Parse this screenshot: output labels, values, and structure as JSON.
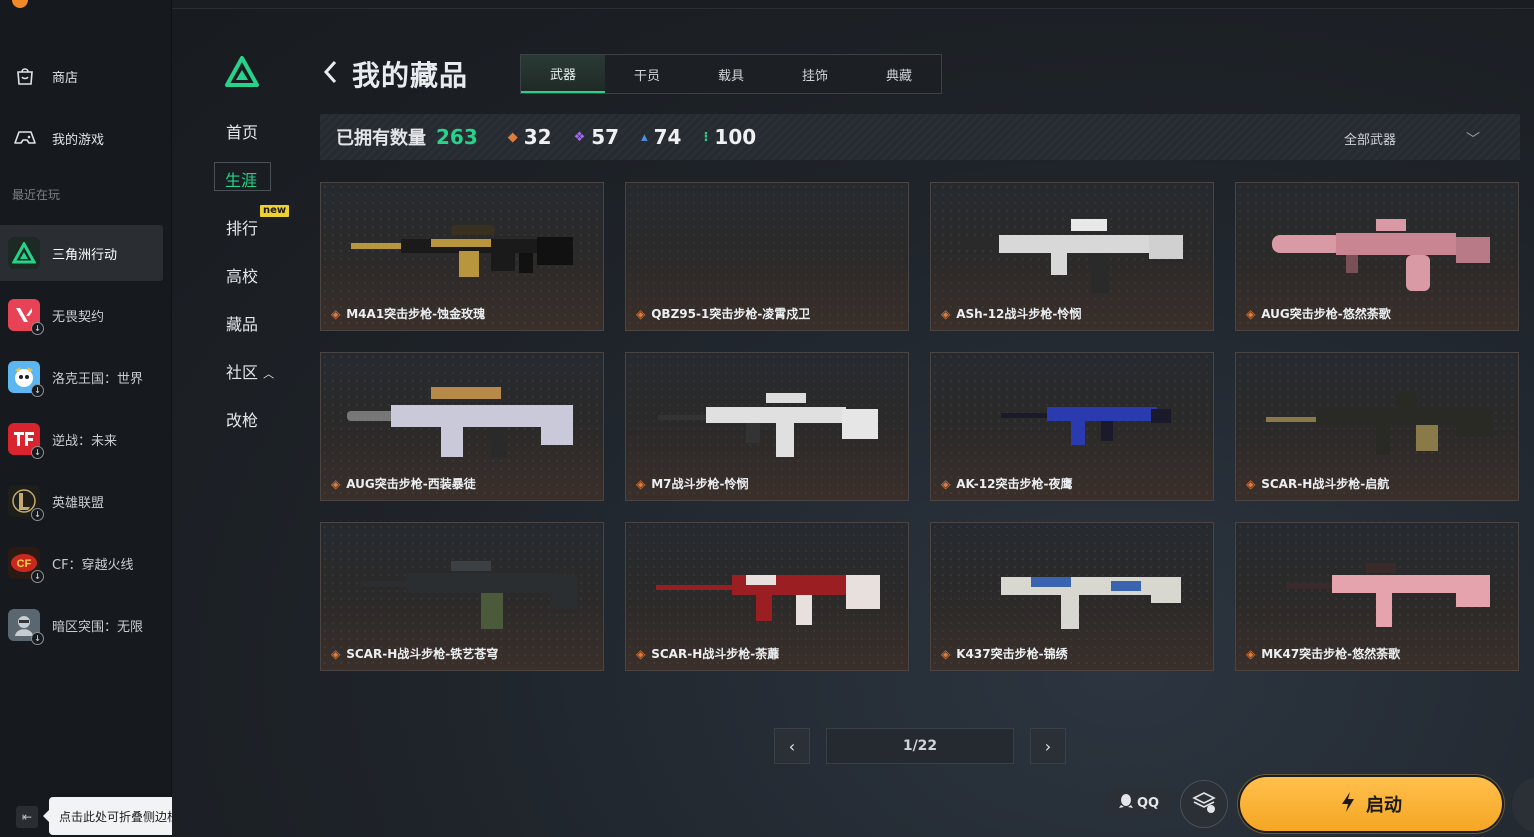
{
  "launcher": {
    "nav": [
      {
        "label": "商店",
        "icon": "shop-bag-icon"
      },
      {
        "label": "我的游戏",
        "icon": "gamepad-icon"
      }
    ],
    "recent_label": "最近在玩",
    "games": [
      {
        "label": "三角洲行动",
        "active": true,
        "color": "#1d2a24",
        "glyph": "▲"
      },
      {
        "label": "无畏契约",
        "active": false,
        "color": "#e84257",
        "glyph": "V"
      },
      {
        "label": "洛克王国：世界",
        "active": false,
        "color": "#5bb6f2",
        "glyph": "洛"
      },
      {
        "label": "逆战：未来",
        "active": false,
        "color": "#d9232d",
        "glyph": "逆"
      },
      {
        "label": "英雄联盟",
        "active": false,
        "color": "#2a2a22",
        "glyph": "L"
      },
      {
        "label": "CF：穿越火线",
        "active": false,
        "color": "#c9281e",
        "glyph": "CF"
      },
      {
        "label": "暗区突围：无限",
        "active": false,
        "color": "#5b6770",
        "glyph": "暗"
      }
    ],
    "collapse_tip": "点击此处可折叠侧边栏"
  },
  "game_nav": {
    "items": [
      {
        "label": "首页",
        "active": false
      },
      {
        "label": "生涯",
        "active": true
      },
      {
        "label": "排行",
        "active": false,
        "badge": "new"
      },
      {
        "label": "高校",
        "active": false
      },
      {
        "label": "藏品",
        "active": false
      },
      {
        "label": "社区",
        "active": false,
        "suffix": "^"
      },
      {
        "label": "改枪",
        "active": false
      }
    ]
  },
  "header": {
    "title": "我的藏品",
    "tabs": [
      {
        "label": "武器",
        "active": true
      },
      {
        "label": "干员",
        "active": false
      },
      {
        "label": "载具",
        "active": false
      },
      {
        "label": "挂饰",
        "active": false
      },
      {
        "label": "典藏",
        "active": false
      }
    ]
  },
  "stats": {
    "owned_label": "已拥有数量",
    "owned_total": "263",
    "tiers": [
      {
        "count": "32",
        "color": "#e07b39"
      },
      {
        "count": "57",
        "color": "#a36bf0"
      },
      {
        "count": "74",
        "color": "#4d8fe8"
      },
      {
        "count": "100",
        "color": "#2fc88a"
      }
    ],
    "filter_label": "全部武器"
  },
  "items": [
    {
      "name": "M4A1突击步枪-蚀金玫瑰",
      "palette": [
        "#1a1a1a",
        "#b8963e"
      ]
    },
    {
      "name": "QBZ95-1突击步枪-凌霄戍卫",
      "palette": [
        "#2a2a2a",
        "#2a2a2a"
      ]
    },
    {
      "name": "ASh-12战斗步枪-怜悯",
      "palette": [
        "#d8d8d8",
        "#2a2a2a"
      ]
    },
    {
      "name": "AUG突击步枪-悠然荼歌",
      "palette": [
        "#d99aa5",
        "#7a4f55"
      ]
    },
    {
      "name": "AUG突击步枪-西装暴徒",
      "palette": [
        "#c9c9d9",
        "#b88a4a"
      ]
    },
    {
      "name": "M7战斗步枪-怜悯",
      "palette": [
        "#e0e0e0",
        "#333333"
      ]
    },
    {
      "name": "AK-12突击步枪-夜鹰",
      "palette": [
        "#2a3bb0",
        "#1a1a2a"
      ]
    },
    {
      "name": "SCAR-H战斗步枪-启航",
      "palette": [
        "#2a2a24",
        "#8a7a4a"
      ]
    },
    {
      "name": "SCAR-H战斗步枪-铁艺苍穹",
      "palette": [
        "#2a2e30",
        "#4a5a3a"
      ]
    },
    {
      "name": "SCAR-H战斗步枪-荼蘼",
      "palette": [
        "#9a1e22",
        "#e8e0dc"
      ]
    },
    {
      "name": "K437突击步枪-锦绣",
      "palette": [
        "#d8d8d0",
        "#3a64b0"
      ]
    },
    {
      "name": "MK47突击步枪-悠然荼歌",
      "palette": [
        "#e4a3ad",
        "#3a2a2c"
      ]
    }
  ],
  "pager": {
    "text": "1/22"
  },
  "actions": {
    "qq_label": "QQ",
    "launch_label": "启动"
  },
  "colors": {
    "accent": "#27d38a",
    "launch": "#f5a623",
    "rarity": "#e07b39"
  }
}
